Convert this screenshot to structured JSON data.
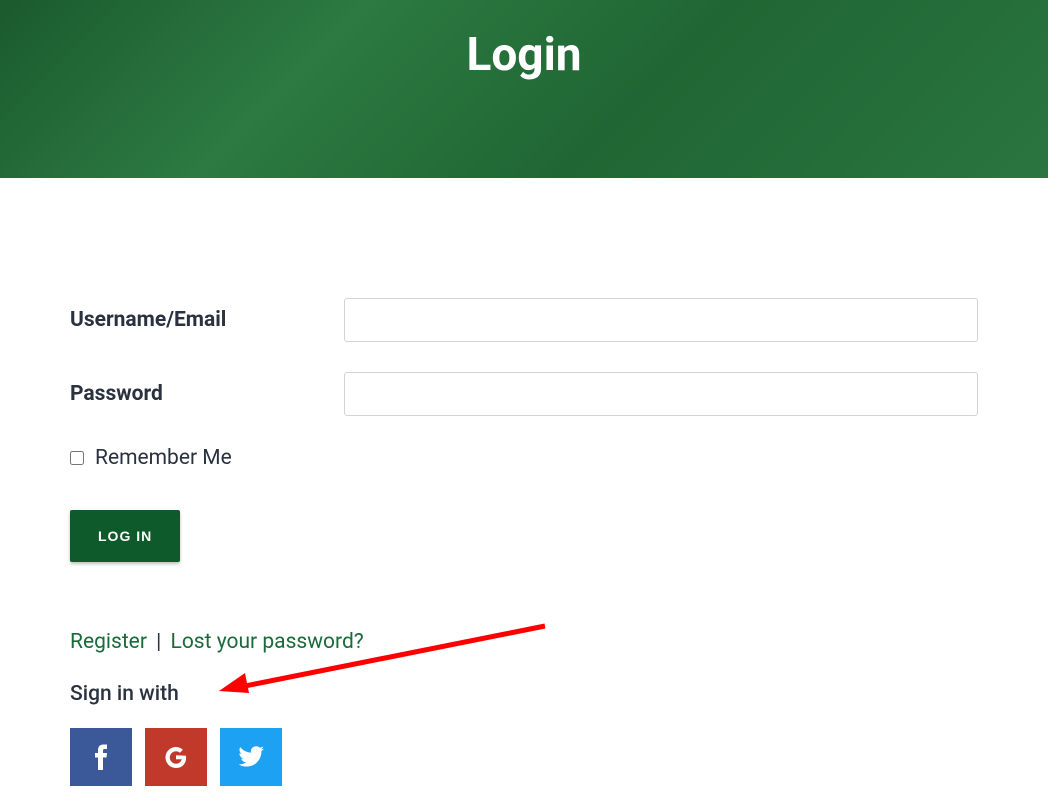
{
  "hero": {
    "title": "Login"
  },
  "form": {
    "username_label": "Username/Email",
    "password_label": "Password",
    "remember_label": "Remember Me",
    "login_button": "LOG IN"
  },
  "links": {
    "register": "Register",
    "separator": "|",
    "lost_password": "Lost your password?"
  },
  "social": {
    "heading": "Sign in with"
  },
  "annotation": {
    "arrow_color": "#ff0000"
  }
}
